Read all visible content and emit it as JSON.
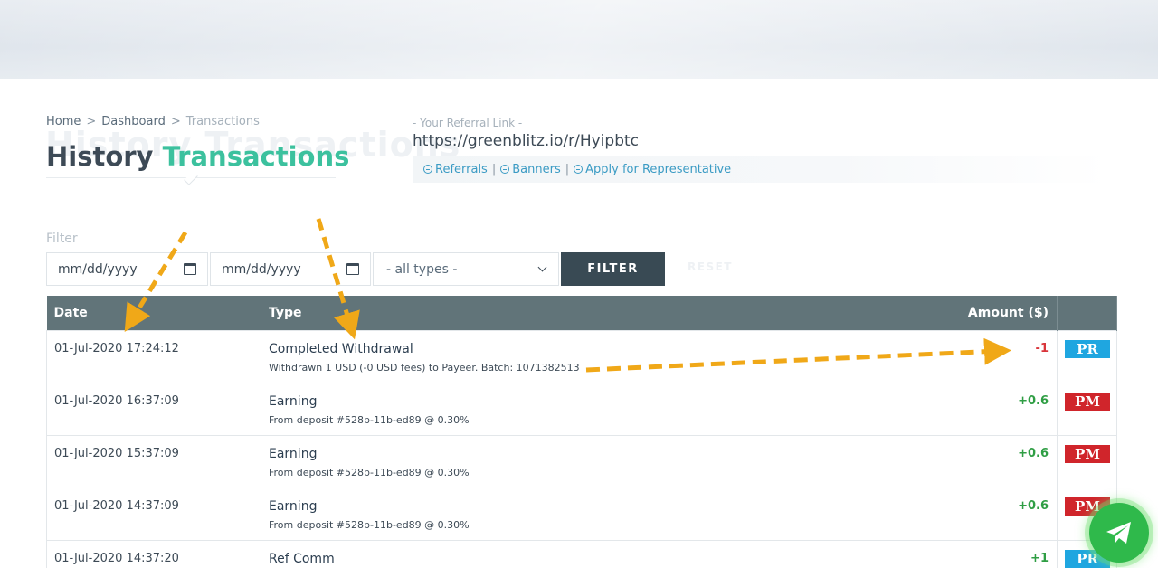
{
  "breadcrumb": {
    "home": "Home",
    "dashboard": "Dashboard",
    "current": "Transactions",
    "separator": ">"
  },
  "page": {
    "title_part1": "History",
    "title_part2": "Transactions",
    "ghost_text": "History Transactions"
  },
  "referral": {
    "label": "- Your Referral Link -",
    "url": "https://greenblitz.io/r/Hyipbtc",
    "links": [
      "Referrals",
      "Banners",
      "Apply for Representative"
    ],
    "link_icon": "circle-minus-icon"
  },
  "filter": {
    "label": "Filter",
    "date_from_placeholder": "mm/dd/yyyy",
    "date_to_placeholder": "mm/dd/yyyy",
    "type_selected": "- all types -",
    "filter_button": "FILTER",
    "reset_button": "RESET"
  },
  "table": {
    "headers": [
      "Date",
      "Type",
      "Amount ($)",
      ""
    ],
    "rows": [
      {
        "date": "01-Jul-2020 17:24:12",
        "type": "Completed Withdrawal",
        "detail": "Withdrawn 1 USD (-0 USD fees) to Payeer. Batch: 1071382513",
        "amount": "-1",
        "sign": "neg",
        "badge": "PR"
      },
      {
        "date": "01-Jul-2020 16:37:09",
        "type": "Earning",
        "detail": "From deposit #528b-11b-ed89 @ 0.30%",
        "amount": "+0.6",
        "sign": "pos",
        "badge": "PM"
      },
      {
        "date": "01-Jul-2020 15:37:09",
        "type": "Earning",
        "detail": "From deposit #528b-11b-ed89 @ 0.30%",
        "amount": "+0.6",
        "sign": "pos",
        "badge": "PM"
      },
      {
        "date": "01-Jul-2020 14:37:09",
        "type": "Earning",
        "detail": "From deposit #528b-11b-ed89 @ 0.30%",
        "amount": "+0.6",
        "sign": "pos",
        "badge": "PM"
      },
      {
        "date": "01-Jul-2020 14:37:20",
        "type": "Ref Comm",
        "detail": "",
        "amount": "+1",
        "sign": "pos",
        "badge": "PR"
      }
    ]
  },
  "colors": {
    "accent_green": "#3cc19e",
    "header_bg": "#617479",
    "filter_button_bg": "#394a54",
    "negative": "#d9343a",
    "positive": "#2f9e44",
    "payeer_badge": "#1fa6e0",
    "perfect_money_badge": "#d0252b",
    "annotation_arrow": "#f0a818",
    "telegram_button": "#2fb94b"
  },
  "telegram_button": {
    "icon": "telegram-plane-icon"
  }
}
